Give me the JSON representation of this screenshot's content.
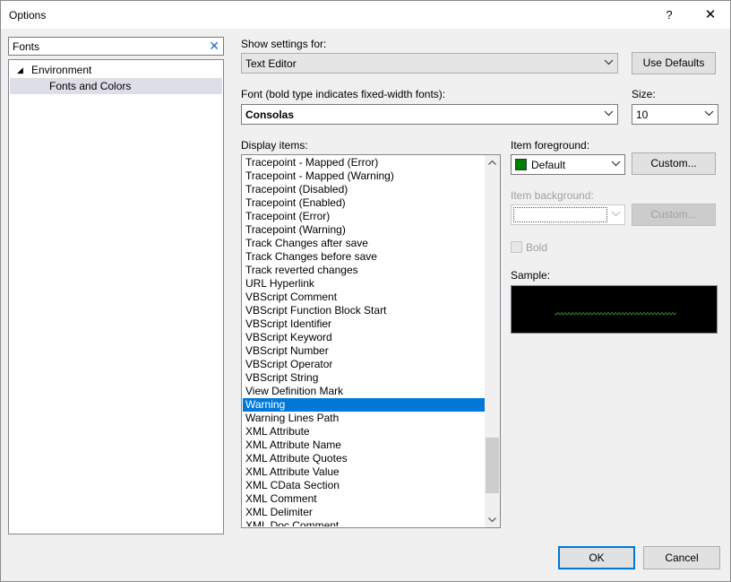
{
  "window": {
    "title": "Options",
    "help": "?",
    "close": "✕"
  },
  "search": {
    "value": "Fonts",
    "clear": "✕"
  },
  "tree": {
    "items": [
      {
        "label": "Environment",
        "expanded": true
      },
      {
        "label": "Fonts and Colors",
        "selected": true
      }
    ]
  },
  "show_settings": {
    "label": "Show settings for:",
    "value": "Text Editor"
  },
  "use_defaults": {
    "label": "Use Defaults"
  },
  "font": {
    "label": "Font (bold type indicates fixed-width fonts):",
    "value": "Consolas"
  },
  "size": {
    "label": "Size:",
    "value": "10"
  },
  "display_items": {
    "label": "Display items:",
    "items": [
      "Tracepoint - Mapped (Error)",
      "Tracepoint - Mapped (Warning)",
      "Tracepoint (Disabled)",
      "Tracepoint (Enabled)",
      "Tracepoint (Error)",
      "Tracepoint (Warning)",
      "Track Changes after save",
      "Track Changes before save",
      "Track reverted changes",
      "URL Hyperlink",
      "VBScript Comment",
      "VBScript Function Block Start",
      "VBScript Identifier",
      "VBScript Keyword",
      "VBScript Number",
      "VBScript Operator",
      "VBScript String",
      "View Definition Mark",
      "Warning",
      "Warning Lines Path",
      "XML Attribute",
      "XML Attribute Name",
      "XML Attribute Quotes",
      "XML Attribute Value",
      "XML CData Section",
      "XML Comment",
      "XML Delimiter",
      "XML Doc Comment"
    ],
    "selected_index": 18,
    "scroll_position": 0.95
  },
  "item_foreground": {
    "label": "Item foreground:",
    "value": "Default",
    "swatch_color": "#008000",
    "custom_label": "Custom..."
  },
  "item_background": {
    "label": "Item background:",
    "value": "",
    "custom_label": "Custom..."
  },
  "bold": {
    "label": "Bold",
    "checked": false
  },
  "sample": {
    "label": "Sample:",
    "background": "#000000",
    "squiggle_color": "#2e8b2e"
  },
  "footer": {
    "ok": "OK",
    "cancel": "Cancel"
  }
}
